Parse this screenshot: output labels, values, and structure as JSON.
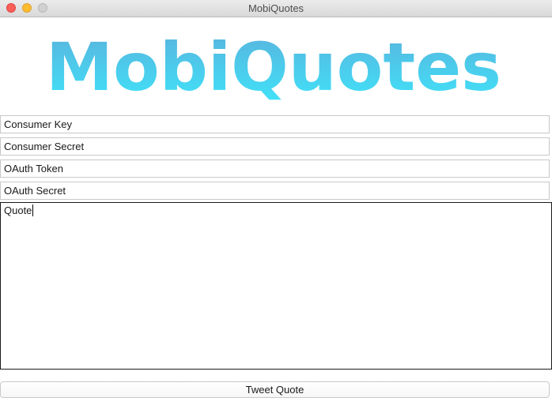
{
  "window": {
    "title": "MobiQuotes"
  },
  "logo": {
    "text": "MobiQuotes",
    "gradient_top": "#5ab2dc",
    "gradient_bottom": "#3fe4fa"
  },
  "fields": {
    "consumer_key": "Consumer Key",
    "consumer_secret": "Consumer Secret",
    "oauth_token": "OAuth Token",
    "oauth_secret": "OAuth Secret"
  },
  "quote": {
    "value": "Quote"
  },
  "actions": {
    "tweet_label": "Tweet Quote"
  },
  "colors": {
    "close": "#fc5f57",
    "minimize": "#fdbc2e",
    "zoom": "#d0d0d0"
  }
}
